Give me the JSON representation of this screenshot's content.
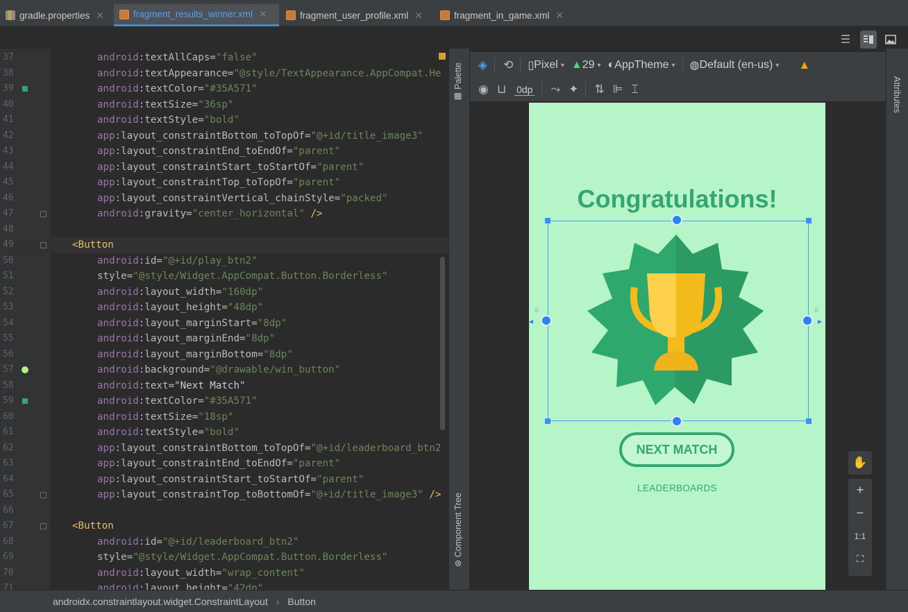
{
  "tabs": [
    {
      "label": "gradle.properties",
      "type": "gradle",
      "active": false
    },
    {
      "label": "fragment_results_winner.xml",
      "type": "xml",
      "active": true
    },
    {
      "label": "fragment_user_profile.xml",
      "type": "xml",
      "active": false
    },
    {
      "label": "fragment_in_game.xml",
      "type": "xml",
      "active": false
    }
  ],
  "view_modes": [
    "code-icon",
    "split-icon",
    "design-icon"
  ],
  "editor": {
    "lines": [
      {
        "n": "37",
        "ind": true,
        "parts": [
          [
            "ns",
            "android"
          ],
          [
            "attr",
            ":textAllCaps="
          ],
          [
            "val",
            "\"false\""
          ]
        ]
      },
      {
        "n": "38",
        "ind": true,
        "parts": [
          [
            "ns",
            "android"
          ],
          [
            "attr",
            ":textAppearance="
          ],
          [
            "val",
            "\"@style/TextAppearance.AppCompat.He"
          ]
        ]
      },
      {
        "n": "39",
        "ind": true,
        "mark": "green",
        "parts": [
          [
            "ns",
            "android"
          ],
          [
            "attr",
            ":textColor="
          ],
          [
            "val",
            "\"#35A571\""
          ]
        ]
      },
      {
        "n": "40",
        "ind": true,
        "parts": [
          [
            "ns",
            "android"
          ],
          [
            "attr",
            ":textSize="
          ],
          [
            "val",
            "\"36sp\""
          ]
        ]
      },
      {
        "n": "41",
        "ind": true,
        "parts": [
          [
            "ns",
            "android"
          ],
          [
            "attr",
            ":textStyle="
          ],
          [
            "val",
            "\"bold\""
          ]
        ]
      },
      {
        "n": "42",
        "ind": true,
        "parts": [
          [
            "ns",
            "app"
          ],
          [
            "attr",
            ":layout_constraintBottom_toTopOf="
          ],
          [
            "val",
            "\"@+id/title_image3\""
          ]
        ]
      },
      {
        "n": "43",
        "ind": true,
        "parts": [
          [
            "ns",
            "app"
          ],
          [
            "attr",
            ":layout_constraintEnd_toEndOf="
          ],
          [
            "val",
            "\"parent\""
          ]
        ]
      },
      {
        "n": "44",
        "ind": true,
        "parts": [
          [
            "ns",
            "app"
          ],
          [
            "attr",
            ":layout_constraintStart_toStartOf="
          ],
          [
            "val",
            "\"parent\""
          ]
        ]
      },
      {
        "n": "45",
        "ind": true,
        "parts": [
          [
            "ns",
            "app"
          ],
          [
            "attr",
            ":layout_constraintTop_toTopOf="
          ],
          [
            "val",
            "\"parent\""
          ]
        ]
      },
      {
        "n": "46",
        "ind": true,
        "parts": [
          [
            "ns",
            "app"
          ],
          [
            "attr",
            ":layout_constraintVertical_chainStyle="
          ],
          [
            "val",
            "\"packed\""
          ]
        ]
      },
      {
        "n": "47",
        "ind": true,
        "fold": true,
        "parts": [
          [
            "ns",
            "android"
          ],
          [
            "attr",
            ":gravity="
          ],
          [
            "val",
            "\"center_horizontal\""
          ],
          [
            "tag",
            " />"
          ]
        ]
      },
      {
        "n": "48",
        "ind": false,
        "parts": []
      },
      {
        "n": "49",
        "ind": false,
        "fold": true,
        "cur": true,
        "parts": [
          [
            "tag",
            "<Button"
          ]
        ]
      },
      {
        "n": "50",
        "ind": true,
        "parts": [
          [
            "ns",
            "android"
          ],
          [
            "attr",
            ":id="
          ],
          [
            "val",
            "\"@+id/play_btn2\""
          ]
        ]
      },
      {
        "n": "51",
        "ind": true,
        "parts": [
          [
            "attr",
            "style="
          ],
          [
            "val",
            "\"@style/Widget.AppCompat.Button.Borderless\""
          ]
        ]
      },
      {
        "n": "52",
        "ind": true,
        "parts": [
          [
            "ns",
            "android"
          ],
          [
            "attr",
            ":layout_width="
          ],
          [
            "val",
            "\"160dp\""
          ]
        ]
      },
      {
        "n": "53",
        "ind": true,
        "parts": [
          [
            "ns",
            "android"
          ],
          [
            "attr",
            ":layout_height="
          ],
          [
            "val",
            "\"48dp\""
          ]
        ]
      },
      {
        "n": "54",
        "ind": true,
        "parts": [
          [
            "ns",
            "android"
          ],
          [
            "attr",
            ":layout_marginStart="
          ],
          [
            "val",
            "\"8dp\""
          ]
        ]
      },
      {
        "n": "55",
        "ind": true,
        "parts": [
          [
            "ns",
            "android"
          ],
          [
            "attr",
            ":layout_marginEnd="
          ],
          [
            "val",
            "\"8dp\""
          ]
        ]
      },
      {
        "n": "56",
        "ind": true,
        "parts": [
          [
            "ns",
            "android"
          ],
          [
            "attr",
            ":layout_marginBottom="
          ],
          [
            "val",
            "\"8dp\""
          ]
        ]
      },
      {
        "n": "57",
        "ind": true,
        "mark": "circle",
        "parts": [
          [
            "ns",
            "android"
          ],
          [
            "attr",
            ":background="
          ],
          [
            "val",
            "\"@drawable/win_button\""
          ]
        ]
      },
      {
        "n": "58",
        "ind": true,
        "parts": [
          [
            "ns",
            "android"
          ],
          [
            "attr",
            ":text="
          ],
          [
            "txt",
            "\"Next Match\""
          ]
        ]
      },
      {
        "n": "59",
        "ind": true,
        "mark": "green",
        "parts": [
          [
            "ns",
            "android"
          ],
          [
            "attr",
            ":textColor="
          ],
          [
            "val",
            "\"#35A571\""
          ]
        ]
      },
      {
        "n": "60",
        "ind": true,
        "parts": [
          [
            "ns",
            "android"
          ],
          [
            "attr",
            ":textSize="
          ],
          [
            "val",
            "\"18sp\""
          ]
        ]
      },
      {
        "n": "61",
        "ind": true,
        "parts": [
          [
            "ns",
            "android"
          ],
          [
            "attr",
            ":textStyle="
          ],
          [
            "val",
            "\"bold\""
          ]
        ]
      },
      {
        "n": "62",
        "ind": true,
        "parts": [
          [
            "ns",
            "app"
          ],
          [
            "attr",
            ":layout_constraintBottom_toTopOf="
          ],
          [
            "val",
            "\"@+id/leaderboard_btn2"
          ]
        ]
      },
      {
        "n": "63",
        "ind": true,
        "parts": [
          [
            "ns",
            "app"
          ],
          [
            "attr",
            ":layout_constraintEnd_toEndOf="
          ],
          [
            "val",
            "\"parent\""
          ]
        ]
      },
      {
        "n": "64",
        "ind": true,
        "parts": [
          [
            "ns",
            "app"
          ],
          [
            "attr",
            ":layout_constraintStart_toStartOf="
          ],
          [
            "val",
            "\"parent\""
          ]
        ]
      },
      {
        "n": "65",
        "ind": true,
        "fold": true,
        "parts": [
          [
            "ns",
            "app"
          ],
          [
            "attr",
            ":layout_constraintTop_toBottomOf="
          ],
          [
            "val",
            "\"@+id/title_image3\""
          ],
          [
            "tag",
            " />"
          ]
        ]
      },
      {
        "n": "66",
        "ind": false,
        "parts": []
      },
      {
        "n": "67",
        "ind": false,
        "fold": true,
        "parts": [
          [
            "tag",
            "<Button"
          ]
        ]
      },
      {
        "n": "68",
        "ind": true,
        "parts": [
          [
            "ns",
            "android"
          ],
          [
            "attr",
            ":id="
          ],
          [
            "val",
            "\"@+id/leaderboard_btn2\""
          ]
        ]
      },
      {
        "n": "69",
        "ind": true,
        "parts": [
          [
            "attr",
            "style="
          ],
          [
            "val",
            "\"@style/Widget.AppCompat.Button.Borderless\""
          ]
        ]
      },
      {
        "n": "70",
        "ind": true,
        "parts": [
          [
            "ns",
            "android"
          ],
          [
            "attr",
            ":layout_width="
          ],
          [
            "val",
            "\"wrap_content\""
          ]
        ]
      },
      {
        "n": "71",
        "ind": true,
        "parts": [
          [
            "ns",
            "android"
          ],
          [
            "attr",
            ":layout_height="
          ],
          [
            "val",
            "\"42dp\""
          ]
        ]
      }
    ]
  },
  "side_panels": {
    "palette": "Palette",
    "component_tree": "Component Tree",
    "attributes": "Attributes"
  },
  "design_toolbar": {
    "device": "Pixel",
    "api": "29",
    "theme": "AppTheme",
    "locale": "Default (en-us)",
    "margin": "0dp"
  },
  "preview": {
    "title": "Congratulations!",
    "next_match": "NEXT MATCH",
    "leaderboards": "LEADERBOARDS",
    "margin_label": "8"
  },
  "zoom": {
    "plus": "+",
    "minus": "−",
    "one_to_one": "1:1"
  },
  "breadcrumb": [
    "androidx.constraintlayout.widget.ConstraintLayout",
    "Button"
  ],
  "colors": {
    "accent": "#35A571",
    "preview_bg": "#B5F5C8",
    "selection": "#2E82F0"
  }
}
